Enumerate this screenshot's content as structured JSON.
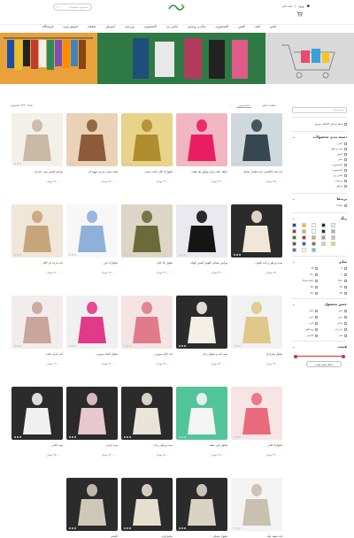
{
  "header": {
    "login_label": "ورود",
    "register_label": "ثبت نام",
    "search_placeholder": "جستجوی محصولات",
    "cart_count": "0"
  },
  "nav": [
    "لباس",
    "کیف",
    "کفش",
    "اکسسوری",
    "شال و روسری",
    "لباس زیر",
    "اکسسوری",
    "ورزشی",
    "آموزش",
    "تخفیف",
    "فروش ویژه",
    "فروشگاه"
  ],
  "breadcrumb": "صفحه اصلی",
  "filterbar": {
    "sort_label": "جدیدترین",
    "count_label": "تعداد: ۲۴۳ محصول"
  },
  "sidebar": {
    "search_placeholder": "جستجو کنید",
    "only_available": "فقط نمایش کالاهای موجود",
    "categories_title": "دسته بندی محصولات",
    "categories": [
      "لباس",
      "کیف و کوله",
      "کفش",
      "شال",
      "اکسسوری",
      "اکسسوری",
      "لباس زیر",
      "ورزشی",
      "پیراهن"
    ],
    "brand_title": "برندها",
    "brand_item": "holly",
    "color_title": "رنگ",
    "colors": [
      "#1a3fbf",
      "#f5c400",
      "#ffffff",
      "#222222",
      "#e8e8e8",
      "#7a4a2a",
      "#c8b46e",
      "#ffffff",
      "#2c2c2c",
      "#b0b0b0",
      "#2e7d32",
      "#c62828",
      "#c9a57a",
      "#9e9e9e",
      "#f4a6b7",
      "#6d4c41",
      "#1565c0",
      "#8e6e4e",
      "#e0cfa9",
      "#d4e157",
      "#5c6bc0",
      "#ffffff",
      "#4dd0e1"
    ],
    "size_title": "سایز",
    "sizes": [
      "S",
      "M",
      "L",
      "XL",
      "XXL",
      "Free size",
      "34",
      "36",
      "38",
      "40"
    ],
    "material_title": "جنس محصول",
    "materials": [
      "نخی",
      "کتان",
      "جین",
      "لینن",
      "ساتن",
      "کرپ",
      "مازراتی",
      "ویسکوز",
      "لمه",
      "کاشمر"
    ],
    "price_title": "قیمت",
    "apply_label": "اعمال فیلتر قیمت"
  },
  "products": [
    {
      "title": "کت بلند انگلیسی جیب فلپدار مخمل",
      "price": "۷۵۰,۰۰۰ تومان"
    },
    {
      "title": "جلیقه بافت برای پولیور یقه هفت",
      "price": "۴۹۰,۰۰۰ تومان"
    },
    {
      "title": "شلوارک کتان بافت دستی",
      "price": "۳۲۰,۰۰۰ تومان"
    },
    {
      "title": "کیف دستی چرمی قهوه ای",
      "price": "۵۹۰,۰۰۰ تومان"
    },
    {
      "title": "پیراهن آستین پفی دخترانه",
      "price": "۴۲۰,۰۰۰ تومان"
    },
    {
      "title": "ست پیراهن و کت بافتنی",
      "price": "۶۸۰,۰۰۰ تومان"
    },
    {
      "title": "پیراهن مشکی کلوش آستین کوتاه",
      "price": "۴۶۰,۰۰۰ تومان"
    },
    {
      "title": "شلوار بگ کتان",
      "price": "۳۹۰,۰۰۰ تومان"
    },
    {
      "title": "شلوارک جین",
      "price": "۲۸۰,۰۰۰ تومان"
    },
    {
      "title": "تاپ پارچه ای گلدار",
      "price": "۲۲۰,۰۰۰ تومان"
    },
    {
      "title": "شلوار طرحدار",
      "price": "۳۴۰,۰۰۰ تومان"
    },
    {
      "title": "ست کت و شلوار زنانه",
      "price": "۸۲۰,۰۰۰ تومان"
    },
    {
      "title": "کت کتان صورتی",
      "price": "۴۸۰,۰۰۰ تومان"
    },
    {
      "title": "شلوار گشاد صورتی",
      "price": "۳۶۰,۰۰۰ تومان"
    },
    {
      "title": "تاپ کراپ بافت",
      "price": "۱۹۰,۰۰۰ تومان"
    },
    {
      "title": "شلوارک قلبی",
      "price": "۲۴۰,۰۰۰ تومان"
    },
    {
      "title": "شلوار جین سفید",
      "price": "۳۸۰,۰۰۰ تومان"
    },
    {
      "title": "ست پیراهن زنانه",
      "price": "۵۱۰,۰۰۰ تومان"
    },
    {
      "title": "بوت چرمی",
      "price": "۹۲۰,۰۰۰ تومان"
    },
    {
      "title": "بوت کتانی",
      "price": "۷۸۰,۰۰۰ تومان"
    },
    {
      "title": "کت سفید بلند",
      "price": "۶۲۰,۰۰۰ تومان"
    },
    {
      "title": "شلوار مشکی",
      "price": "۳۱۰,۰۰۰ تومان"
    },
    {
      "title": "مانتو کرم",
      "price": "۵۵۰,۰۰۰ تومان"
    },
    {
      "title": "کاپشن",
      "price": "۸۹۰,۰۰۰ تومان"
    }
  ]
}
